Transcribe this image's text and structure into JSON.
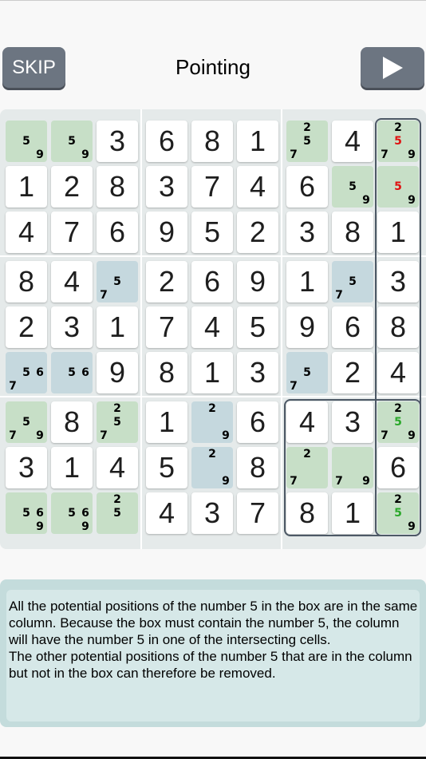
{
  "header": {
    "skip_label": "SKIP",
    "title": "Pointing",
    "play_icon": "play-icon"
  },
  "colors": {
    "given_bg": "#ffffff",
    "green_cell": "#c7dfc7",
    "blue_cell": "#c5d8de",
    "candidate": "#000000",
    "removed_candidate": "#e01010",
    "kept_candidate": "#2aa82a",
    "highlight_border": "#4d5966"
  },
  "highlight": {
    "column": 9,
    "box": 9,
    "number": 5
  },
  "board": [
    [
      {
        "c": [
          "5",
          "9"
        ],
        "bg": "green"
      },
      {
        "c": [
          "5",
          "9"
        ],
        "bg": "green"
      },
      {
        "v": "3"
      },
      {
        "v": "6"
      },
      {
        "v": "8"
      },
      {
        "v": "1"
      },
      {
        "c": [
          "2",
          "5",
          "7"
        ],
        "bg": "green"
      },
      {
        "v": "4"
      },
      {
        "c": [
          "2",
          "5",
          "7",
          "9"
        ],
        "bg": "green",
        "marks": {
          "5": "red"
        }
      }
    ],
    [
      {
        "v": "1"
      },
      {
        "v": "2"
      },
      {
        "v": "8"
      },
      {
        "v": "3"
      },
      {
        "v": "7"
      },
      {
        "v": "4"
      },
      {
        "v": "6"
      },
      {
        "c": [
          "5",
          "9"
        ],
        "bg": "green"
      },
      {
        "c": [
          "5",
          "9"
        ],
        "bg": "green",
        "marks": {
          "5": "red"
        }
      }
    ],
    [
      {
        "v": "4"
      },
      {
        "v": "7"
      },
      {
        "v": "6"
      },
      {
        "v": "9"
      },
      {
        "v": "5"
      },
      {
        "v": "2"
      },
      {
        "v": "3"
      },
      {
        "v": "8"
      },
      {
        "v": "1"
      }
    ],
    [
      {
        "v": "8"
      },
      {
        "v": "4"
      },
      {
        "c": [
          "5",
          "7"
        ],
        "bg": "blue"
      },
      {
        "v": "2"
      },
      {
        "v": "6"
      },
      {
        "v": "9"
      },
      {
        "v": "1"
      },
      {
        "c": [
          "5",
          "7"
        ],
        "bg": "blue"
      },
      {
        "v": "3"
      }
    ],
    [
      {
        "v": "2"
      },
      {
        "v": "3"
      },
      {
        "v": "1"
      },
      {
        "v": "7"
      },
      {
        "v": "4"
      },
      {
        "v": "5"
      },
      {
        "v": "9"
      },
      {
        "v": "6"
      },
      {
        "v": "8"
      }
    ],
    [
      {
        "c": [
          "5",
          "6",
          "7"
        ],
        "bg": "blue"
      },
      {
        "c": [
          "5",
          "6"
        ],
        "bg": "blue"
      },
      {
        "v": "9"
      },
      {
        "v": "8"
      },
      {
        "v": "1"
      },
      {
        "v": "3"
      },
      {
        "c": [
          "5",
          "7"
        ],
        "bg": "blue"
      },
      {
        "v": "2"
      },
      {
        "v": "4"
      }
    ],
    [
      {
        "c": [
          "5",
          "7",
          "9"
        ],
        "bg": "green"
      },
      {
        "v": "8"
      },
      {
        "c": [
          "2",
          "5",
          "7"
        ],
        "bg": "green"
      },
      {
        "v": "1"
      },
      {
        "c": [
          "2",
          "9"
        ],
        "bg": "blue"
      },
      {
        "v": "6"
      },
      {
        "v": "4"
      },
      {
        "v": "3"
      },
      {
        "c": [
          "2",
          "5",
          "7",
          "9"
        ],
        "bg": "green",
        "marks": {
          "5": "green"
        }
      }
    ],
    [
      {
        "v": "3"
      },
      {
        "v": "1"
      },
      {
        "v": "4"
      },
      {
        "v": "5"
      },
      {
        "c": [
          "2",
          "9"
        ],
        "bg": "blue"
      },
      {
        "v": "8"
      },
      {
        "c": [
          "2",
          "7"
        ],
        "bg": "green"
      },
      {
        "c": [
          "7",
          "9"
        ],
        "bg": "green"
      },
      {
        "v": "6"
      }
    ],
    [
      {
        "c": [
          "5",
          "6",
          "9"
        ],
        "bg": "green"
      },
      {
        "c": [
          "5",
          "6",
          "9"
        ],
        "bg": "green"
      },
      {
        "c": [
          "2",
          "5"
        ],
        "bg": "green"
      },
      {
        "v": "4"
      },
      {
        "v": "3"
      },
      {
        "v": "7"
      },
      {
        "v": "8"
      },
      {
        "v": "1"
      },
      {
        "c": [
          "2",
          "5",
          "9"
        ],
        "bg": "green",
        "marks": {
          "5": "green"
        }
      }
    ]
  ],
  "explanation": {
    "line1": "All the potential positions of the number 5 in the box are in the same column. Because the box must contain the number 5, the column will have the number 5 in one of the intersecting cells.",
    "line2": "The other potential positions of the number 5 that are in the column but not in the box can therefore be removed."
  }
}
